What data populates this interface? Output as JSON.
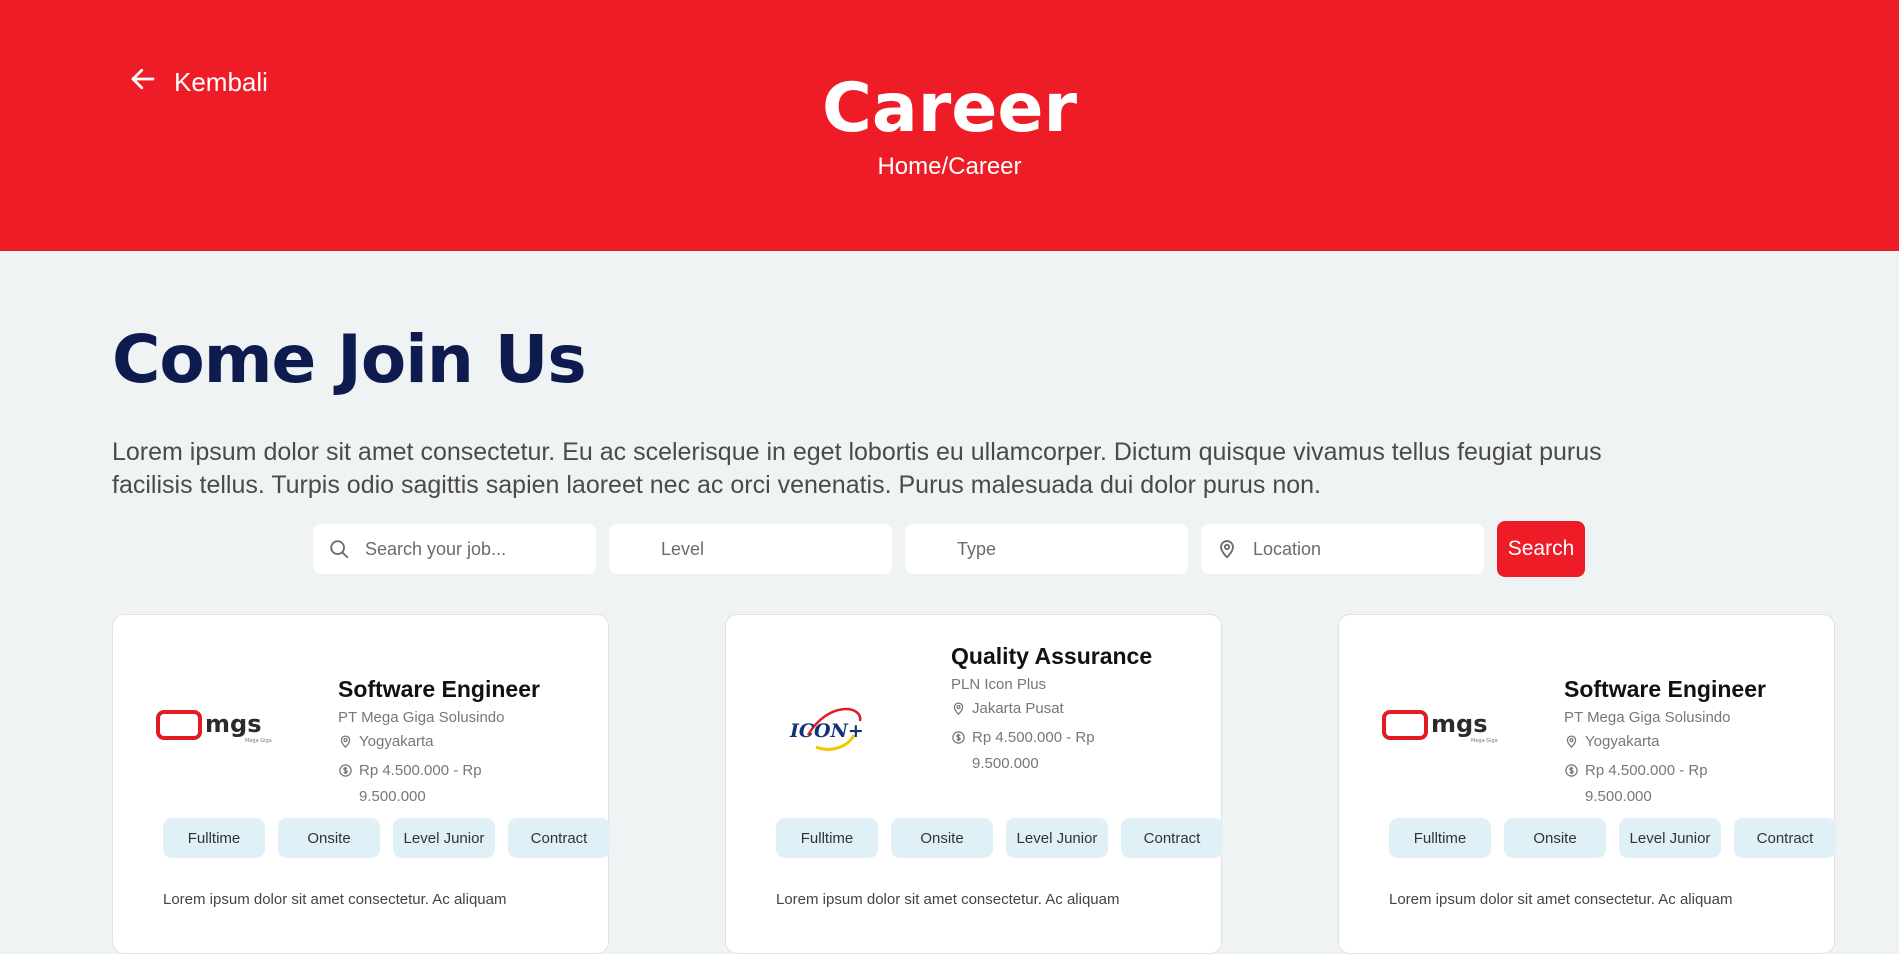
{
  "header": {
    "back_label": "Kembali",
    "title": "Career",
    "breadcrumb": "Home/Career",
    "accent_color": "#ee1c27"
  },
  "main": {
    "heading": "Come Join Us",
    "intro": "Lorem ipsum dolor sit amet consectetur. Eu ac scelerisque in eget lobortis eu ullamcorper. Dictum quisque vivamus tellus feugiat purus facilisis tellus. Turpis odio sagittis sapien laoreet nec ac orci venenatis. Purus malesuada dui dolor purus non."
  },
  "search": {
    "keyword_placeholder": "Search your job...",
    "level_placeholder": "Level",
    "type_placeholder": "Type",
    "location_placeholder": "Location",
    "button_label": "Search"
  },
  "jobs": [
    {
      "title": "Software Engineer",
      "company": "PT Mega Giga Solusindo",
      "location": "Yogyakarta",
      "salary": "Rp 4.500.000 - Rp 9.500.000",
      "logo": "mgs-logo",
      "tags": [
        "Fulltime",
        "Onsite",
        "Level Junior",
        "Contract"
      ],
      "description": "Lorem ipsum dolor sit amet consectetur. Ac aliquam"
    },
    {
      "title": "Quality Assurance",
      "company": "PLN Icon Plus",
      "location": "Jakarta Pusat",
      "salary": "Rp 4.500.000 - Rp 9.500.000",
      "logo": "icon-plus-logo",
      "tags": [
        "Fulltime",
        "Onsite",
        "Level Junior",
        "Contract"
      ],
      "description": "Lorem ipsum dolor sit amet consectetur. Ac aliquam"
    },
    {
      "title": "Software Engineer",
      "company": "PT Mega Giga Solusindo",
      "location": "Yogyakarta",
      "salary": "Rp 4.500.000 - Rp 9.500.000",
      "logo": "mgs-logo",
      "tags": [
        "Fulltime",
        "Onsite",
        "Level Junior",
        "Contract"
      ],
      "description": "Lorem ipsum dolor sit amet consectetur. Ac aliquam"
    }
  ]
}
